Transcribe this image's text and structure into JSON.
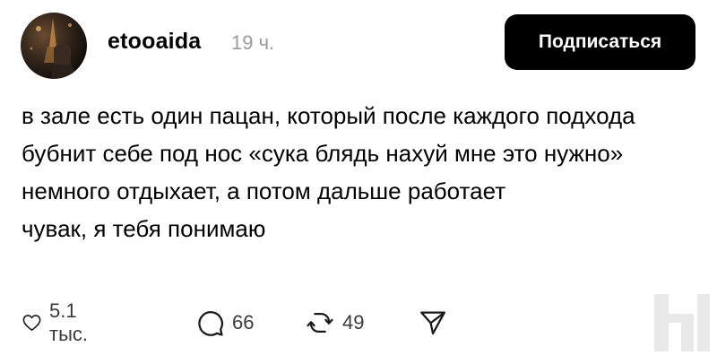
{
  "header": {
    "username": "etooaida",
    "time": "19 ч.",
    "subscribe_label": "Подписаться"
  },
  "post": {
    "paragraphs": [
      "в зале есть один пацан, который после каждого подхода бубнит себе под нос «сука блядь нахуй мне это нужно» немного отдыхает, а потом дальше работает",
      "чувак, я тебя понимаю"
    ]
  },
  "actions": {
    "likes": {
      "icon": "heart-icon",
      "count": "5.1 тыс."
    },
    "comments": {
      "icon": "comment-icon",
      "count": "66"
    },
    "reposts": {
      "icon": "repost-icon",
      "count": "49"
    },
    "share": {
      "icon": "send-icon"
    }
  },
  "watermark": {
    "icon": "brand-logo"
  },
  "colors": {
    "background": "#ffffff",
    "text": "#000000",
    "muted": "#9a9a9a",
    "button": "#000000",
    "watermark": "#e9e9e9"
  }
}
